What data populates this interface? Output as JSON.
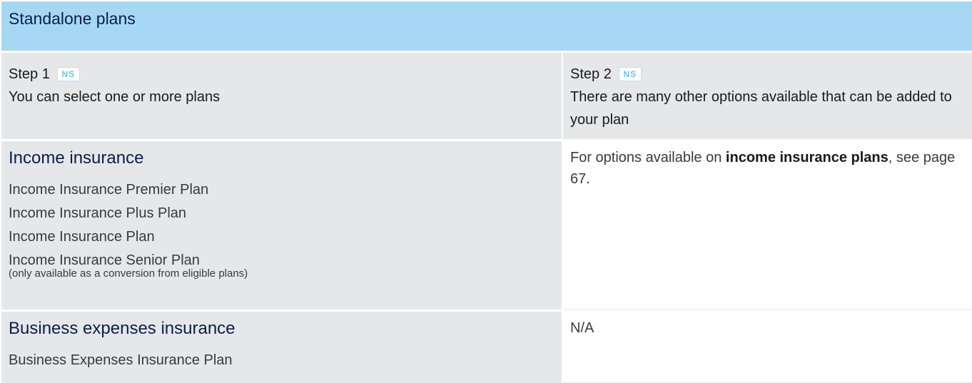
{
  "header": {
    "title": "Standalone plans"
  },
  "steps": {
    "step1": {
      "title": "Step 1",
      "badge": "NS",
      "description": "You can select one or more plans"
    },
    "step2": {
      "title": "Step 2",
      "badge": "NS",
      "description": "There are many other options available that can be added to your plan"
    }
  },
  "categories": [
    {
      "title": "Income insurance",
      "plans": [
        "Income Insurance Premier Plan",
        "Income Insurance Plus Plan",
        "Income Insurance Plan",
        "Income Insurance Senior Plan"
      ],
      "note": "(only available as a conversion from eligible plans)",
      "options": {
        "prefix": "For options available on ",
        "emphasis": "income insurance plans",
        "suffix": ", see page 67."
      }
    },
    {
      "title": "Business expenses insurance",
      "plans": [
        "Business Expenses Insurance Plan"
      ],
      "options": {
        "text": "N/A"
      }
    }
  ]
}
